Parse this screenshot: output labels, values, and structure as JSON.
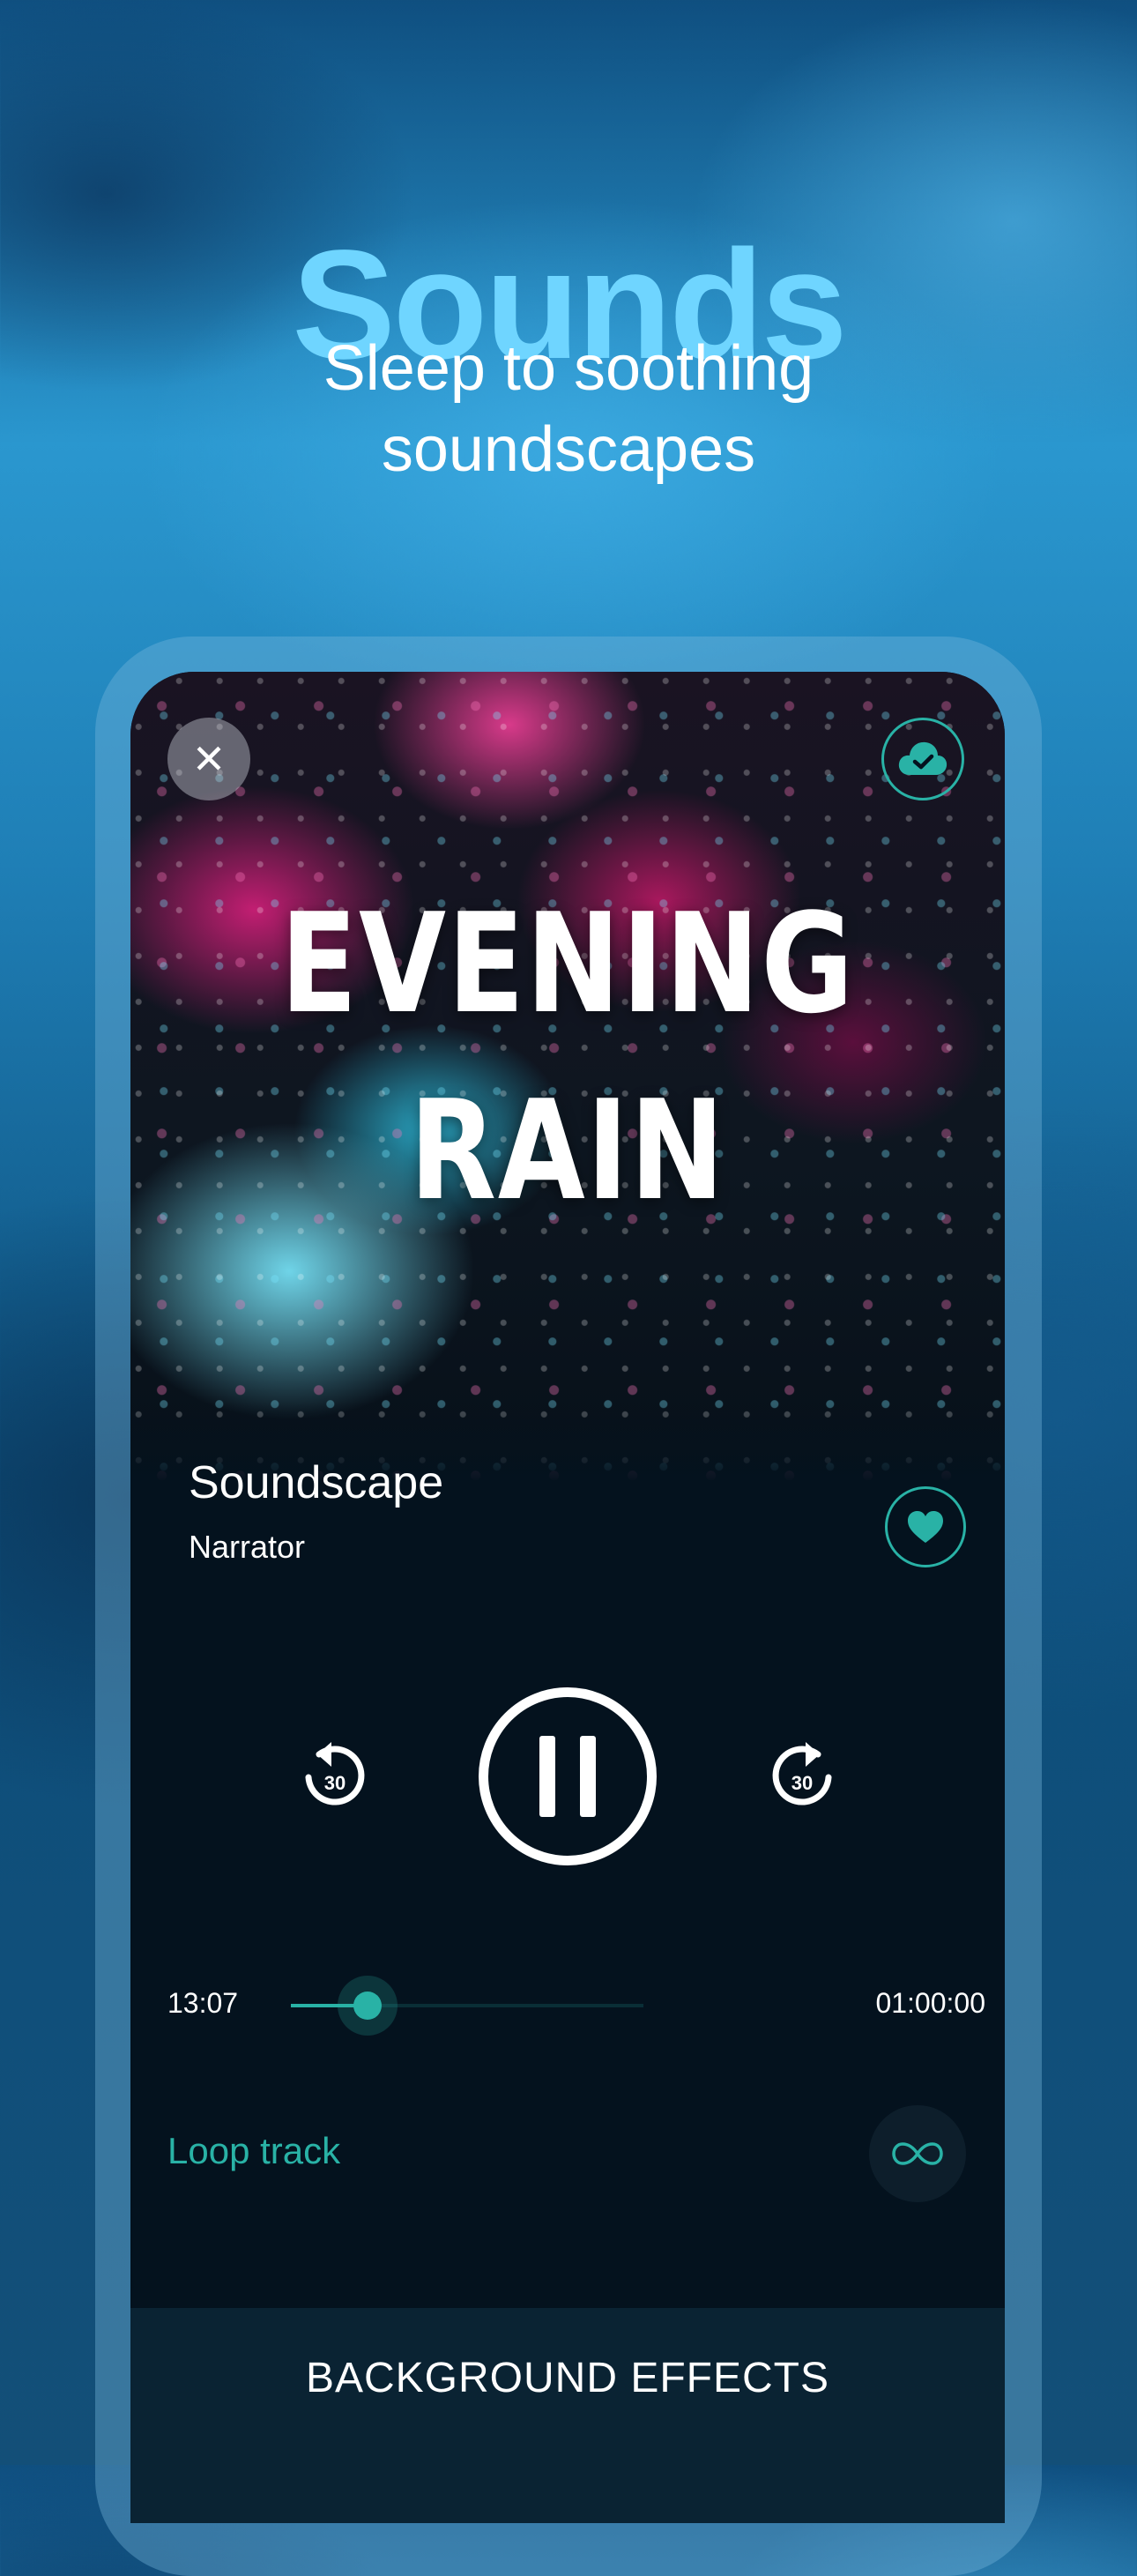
{
  "promo": {
    "title": "Sounds",
    "subtitle_line1": "Sleep to soothing",
    "subtitle_line2": "soundscapes"
  },
  "player": {
    "artwork_title_line1": "EVENING",
    "artwork_title_line2": "RAIN",
    "close_glyph": "✕",
    "track_title": "Soundscape",
    "track_artist": "Narrator",
    "skip_back_seconds": "30",
    "skip_forward_seconds": "30",
    "time_elapsed": "13:07",
    "time_total": "01:00:00",
    "progress_fraction": 0.2186,
    "loop_label": "Loop track",
    "background_effects_label": "BACKGROUND EFFECTS",
    "downloaded": true,
    "favorited": true,
    "playing": true
  },
  "icons": {
    "close": "close-icon",
    "download": "cloud-check-icon",
    "favorite": "heart-icon",
    "rewind": "rewind-30-icon",
    "pause": "pause-icon",
    "forward": "forward-30-icon",
    "loop": "infinity-icon"
  },
  "colors": {
    "accent": "#29b2a6",
    "title": "#6fd5ff",
    "screen_bg": "#04121e",
    "bottom_bar": "#0a2333"
  }
}
